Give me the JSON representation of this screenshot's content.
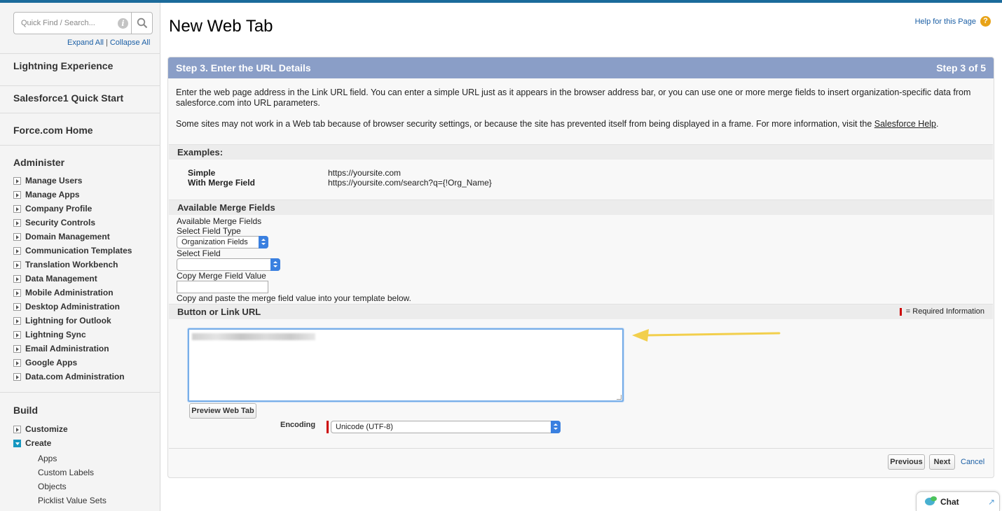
{
  "sidebar": {
    "search_placeholder": "Quick Find / Search...",
    "expand_all": "Expand All",
    "separator": "|",
    "collapse_all": "Collapse All",
    "sections": [
      "Lightning Experience",
      "Salesforce1 Quick Start",
      "Force.com Home"
    ],
    "administer": {
      "heading": "Administer",
      "items": [
        "Manage Users",
        "Manage Apps",
        "Company Profile",
        "Security Controls",
        "Domain Management",
        "Communication Templates",
        "Translation Workbench",
        "Data Management",
        "Mobile Administration",
        "Desktop Administration",
        "Lightning for Outlook",
        "Lightning Sync",
        "Email Administration",
        "Google Apps",
        "Data.com Administration"
      ]
    },
    "build": {
      "heading": "Build",
      "items": [
        "Customize",
        "Create"
      ],
      "create_children": [
        "Apps",
        "Custom Labels",
        "Objects",
        "Picklist Value Sets"
      ]
    }
  },
  "page": {
    "title": "New Web Tab",
    "help_link": "Help for this Page",
    "help_icon": "?"
  },
  "step": {
    "label": "Step 3. Enter the URL Details",
    "counter": "Step 3 of 5"
  },
  "intro": {
    "p1": "Enter the web page address in the Link URL field. You can enter a simple URL just as it appears in the browser address bar, or you can use one or more merge fields to insert organization-specific data from salesforce.com into URL parameters.",
    "p2_prefix": "Some sites may not work in a Web tab because of browser security settings, or because the site has prevented itself from being displayed in a frame. For more information, visit the ",
    "p2_link": "Salesforce Help",
    "p2_suffix": "."
  },
  "examples": {
    "heading": "Examples:",
    "rows": [
      {
        "label": "Simple",
        "value": "https://yoursite.com"
      },
      {
        "label": "With Merge Field",
        "value": "https://yoursite.com/search?q={!Org_Name}"
      }
    ]
  },
  "merge": {
    "heading": "Available Merge Fields",
    "sub_label": "Available Merge Fields",
    "field_type_label": "Select Field Type",
    "field_type_value": "Organization Fields",
    "select_field_label": "Select Field",
    "select_field_value": "",
    "copy_label": "Copy Merge Field Value",
    "copy_value": "",
    "copy_hint": "Copy and paste the merge field value into your template below."
  },
  "url_section": {
    "heading": "Button or Link URL",
    "required_legend": "= Required Information",
    "preview_button": "Preview Web Tab",
    "encoding_label": "Encoding",
    "encoding_value": "Unicode (UTF-8)"
  },
  "footer": {
    "previous": "Previous",
    "next": "Next",
    "cancel": "Cancel"
  },
  "chat": {
    "label": "Chat",
    "expand_icon": "↗"
  },
  "colors": {
    "step_header": "#8a9ec7",
    "link": "#1b5fa5",
    "required": "#cc0000",
    "annotation_arrow": "#f2cf4c"
  }
}
